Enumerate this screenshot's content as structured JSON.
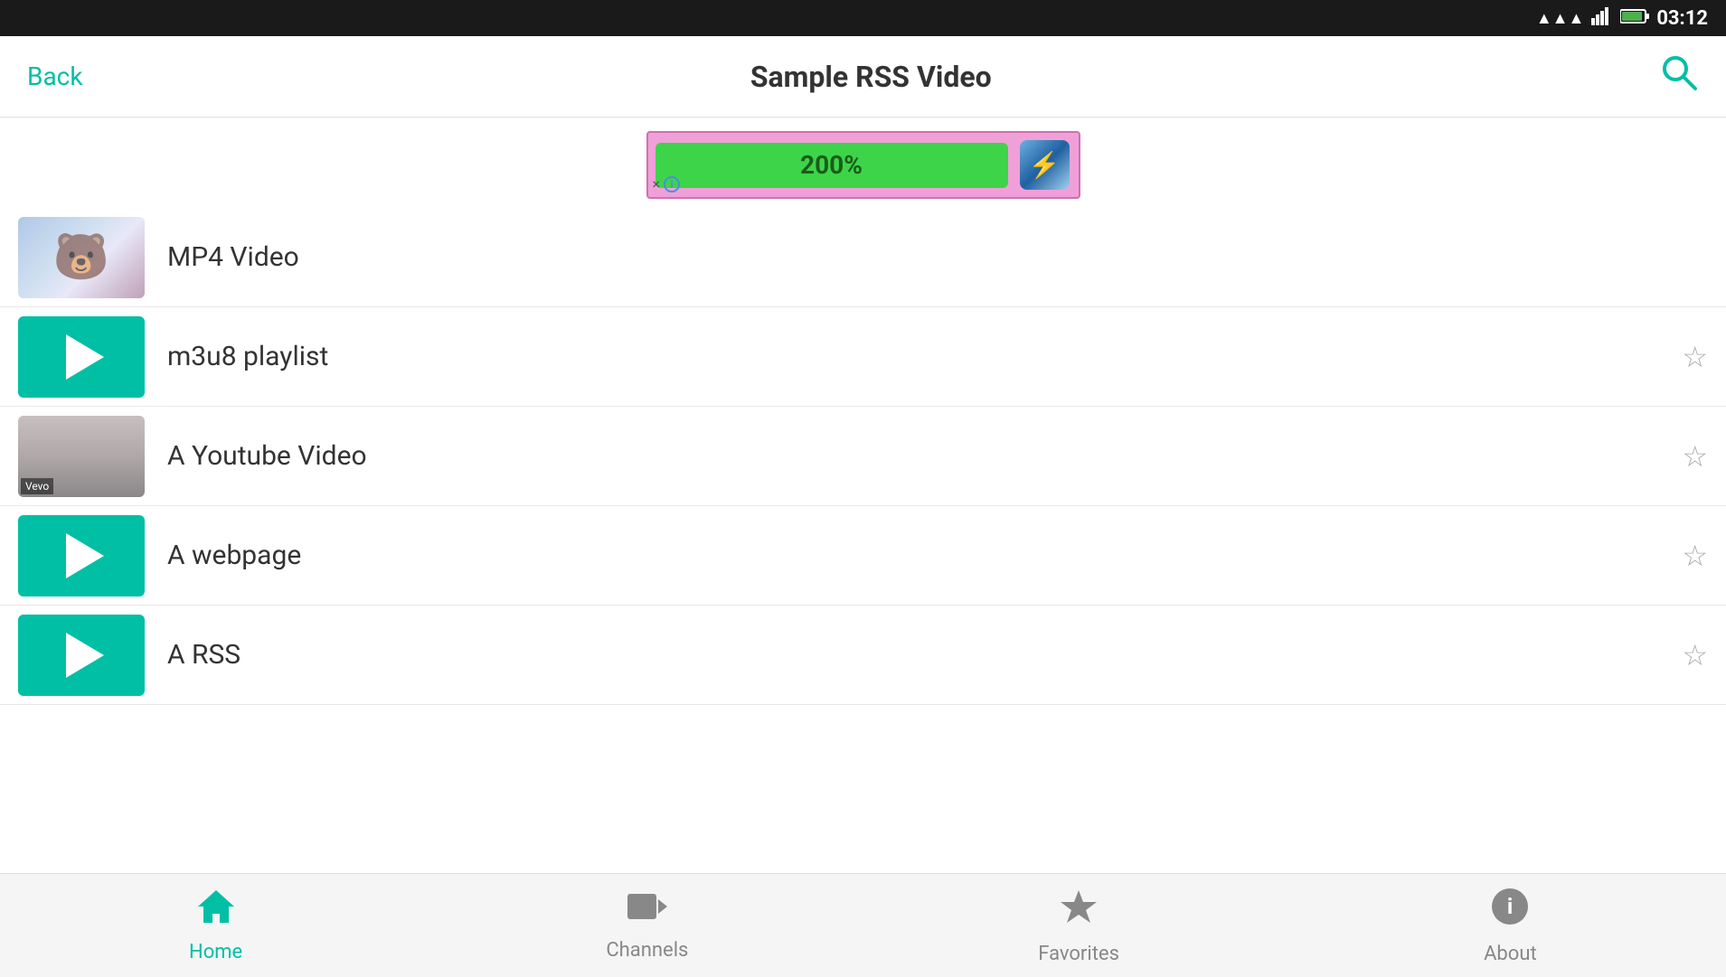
{
  "statusBar": {
    "time": "03:12"
  },
  "header": {
    "backLabel": "Back",
    "title": "Sample RSS Video",
    "searchAriaLabel": "Search"
  },
  "ad": {
    "percentage": "200%",
    "closeLabel": "×",
    "infoLabel": "i"
  },
  "listItems": [
    {
      "id": "mp4-video",
      "title": "MP4 Video",
      "thumbnailType": "image-mp4",
      "hasStar": false
    },
    {
      "id": "m3u8-playlist",
      "title": "m3u8 playlist",
      "thumbnailType": "play",
      "hasStar": true
    },
    {
      "id": "youtube-video",
      "title": "A Youtube Video",
      "thumbnailType": "image-youtube",
      "hasStar": true
    },
    {
      "id": "webpage",
      "title": "A webpage",
      "thumbnailType": "play",
      "hasStar": true
    },
    {
      "id": "rss",
      "title": "A RSS",
      "thumbnailType": "play",
      "hasStar": true
    }
  ],
  "bottomNav": {
    "items": [
      {
        "id": "home",
        "label": "Home",
        "icon": "🏠",
        "active": true
      },
      {
        "id": "channels",
        "label": "Channels",
        "icon": "📹",
        "active": false
      },
      {
        "id": "favorites",
        "label": "Favorites",
        "icon": "⭐",
        "active": false
      },
      {
        "id": "about",
        "label": "About",
        "icon": "ℹ️",
        "active": false
      }
    ]
  }
}
